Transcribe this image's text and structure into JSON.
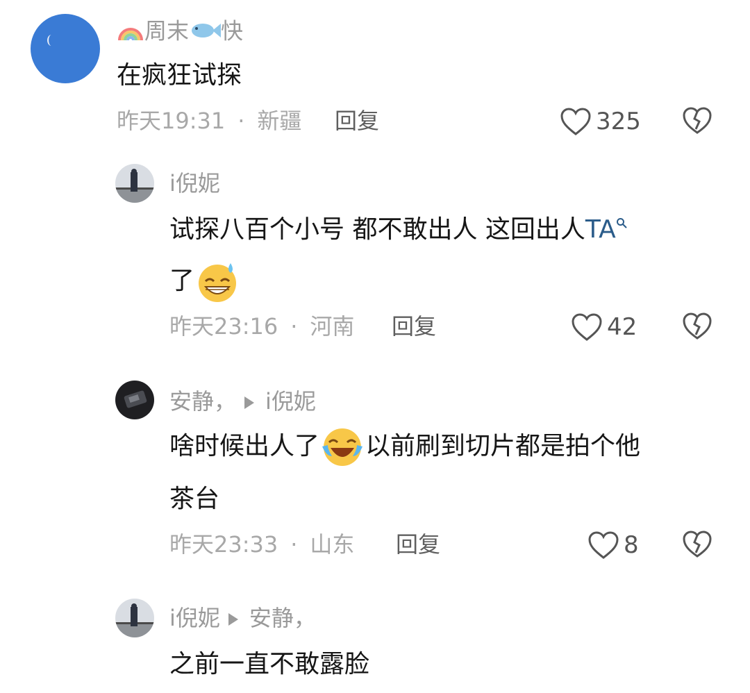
{
  "comments": [
    {
      "username_prefix_icon": "rainbow-icon",
      "username_a": "周末",
      "username_mid_icon": "fish-icon",
      "username_b": "快",
      "text": "在疯狂试探",
      "time": "昨天19:31",
      "location": "新疆",
      "reply_label": "回复",
      "likes": "325"
    },
    {
      "username": "i倪妮",
      "text_line1_a": "试探八百个小号 都不敢出人 这回出人",
      "text_line1_link": "TA",
      "text_line2": "了",
      "emoji": "grinning-sweat-emoji",
      "time": "昨天23:16",
      "location": "河南",
      "reply_label": "回复",
      "likes": "42"
    },
    {
      "username": "安静，",
      "reply_to": "i倪妮",
      "text_line1_a": "啥时候出人了",
      "emoji": "laughing-tears-emoji",
      "text_line1_b": "以前刷到切片都是拍个他",
      "text_line2": "茶台",
      "time": "昨天23:33",
      "location": "山东",
      "reply_label": "回复",
      "likes": "8"
    },
    {
      "username": "i倪妮",
      "reply_to": "安静，",
      "text": "之前一直不敢露脸"
    }
  ],
  "separator_dot": "·",
  "colors": {
    "text": "#161616",
    "meta": "#a8a8a8",
    "link": "#2b5c8a",
    "avatar_blue": "#3a7bd5"
  }
}
